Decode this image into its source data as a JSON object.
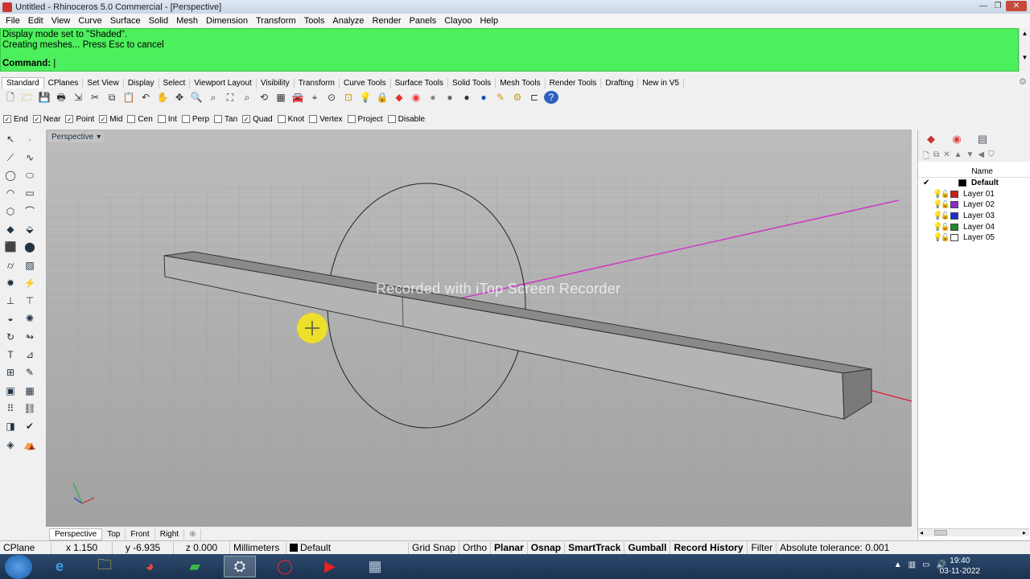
{
  "window": {
    "title": "Untitled - Rhinoceros 5.0 Commercial - [Perspective]"
  },
  "menu": [
    "File",
    "Edit",
    "View",
    "Curve",
    "Surface",
    "Solid",
    "Mesh",
    "Dimension",
    "Transform",
    "Tools",
    "Analyze",
    "Render",
    "Panels",
    "Clayoo",
    "Help"
  ],
  "command_area": {
    "history_1": "Display mode set to \"Shaded\".",
    "history_2": "Creating meshes... Press Esc to cancel",
    "prompt_label": "Command:",
    "background": "#4cf05c"
  },
  "toolbar_tabs": [
    "Standard",
    "CPlanes",
    "Set View",
    "Display",
    "Select",
    "Viewport Layout",
    "Visibility",
    "Transform",
    "Curve Tools",
    "Surface Tools",
    "Solid Tools",
    "Mesh Tools",
    "Render Tools",
    "Drafting",
    "New in V5"
  ],
  "osnaps": [
    {
      "label": "End",
      "checked": true
    },
    {
      "label": "Near",
      "checked": true
    },
    {
      "label": "Point",
      "checked": true
    },
    {
      "label": "Mid",
      "checked": true
    },
    {
      "label": "Cen",
      "checked": false
    },
    {
      "label": "Int",
      "checked": false
    },
    {
      "label": "Perp",
      "checked": false
    },
    {
      "label": "Tan",
      "checked": false
    },
    {
      "label": "Quad",
      "checked": true
    },
    {
      "label": "Knot",
      "checked": false
    },
    {
      "label": "Vertex",
      "checked": false
    },
    {
      "label": "Project",
      "checked": false
    },
    {
      "label": "Disable",
      "checked": false
    }
  ],
  "viewport": {
    "label": "Perspective",
    "watermark": "Recorded with iTop Screen Recorder"
  },
  "viewport_tabs": [
    "Perspective",
    "Top",
    "Front",
    "Right"
  ],
  "layers": {
    "column_header": "Name",
    "items": [
      {
        "name": "Default",
        "color": "#000000",
        "current": true
      },
      {
        "name": "Layer 01",
        "color": "#d01c1c",
        "current": false
      },
      {
        "name": "Layer 02",
        "color": "#8a2bc8",
        "current": false
      },
      {
        "name": "Layer 03",
        "color": "#1930d8",
        "current": false
      },
      {
        "name": "Layer 04",
        "color": "#1a8a2a",
        "current": false
      },
      {
        "name": "Layer 05",
        "color": "#ffffff",
        "current": false
      }
    ]
  },
  "status": {
    "cplane": "CPlane",
    "x": "x 1.150",
    "y": "y -6.935",
    "z": "z 0.000",
    "units": "Millimeters",
    "layer": "Default",
    "grid_snap": "Grid Snap",
    "ortho": "Ortho",
    "planar": "Planar",
    "osnap": "Osnap",
    "smarttrack": "SmartTrack",
    "gumball": "Gumball",
    "record_history": "Record History",
    "filter": "Filter",
    "tolerance": "Absolute tolerance: 0.001"
  },
  "clock": {
    "time": "19:40",
    "date": "03-11-2022"
  },
  "icons": [
    "rhino-app-icon",
    "windows-start-icon",
    "ie-icon",
    "explorer-icon",
    "chrome-icon",
    "app-green-icon",
    "rhino-task-icon",
    "opera-icon",
    "youtube-icon",
    "calculator-icon"
  ]
}
